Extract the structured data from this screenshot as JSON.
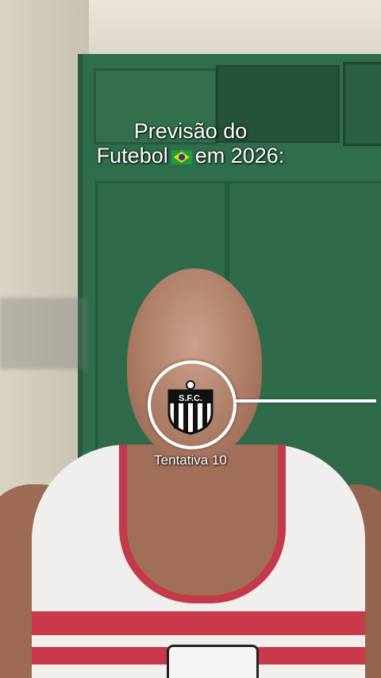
{
  "overlay": {
    "title_line1": "Previsão do",
    "title_line2_a": "Futebol",
    "title_line2_b": "em 2026:",
    "attempt_label": "Tentativa 10",
    "crest_letters": "S.F.C."
  },
  "icons": {
    "flag": "brazil-flag-icon",
    "crest": "santos-fc-crest-icon"
  },
  "colors": {
    "text": "#ffffff",
    "wardrobe": "#2f6e4c",
    "shirt_stripe": "#c8394a"
  }
}
